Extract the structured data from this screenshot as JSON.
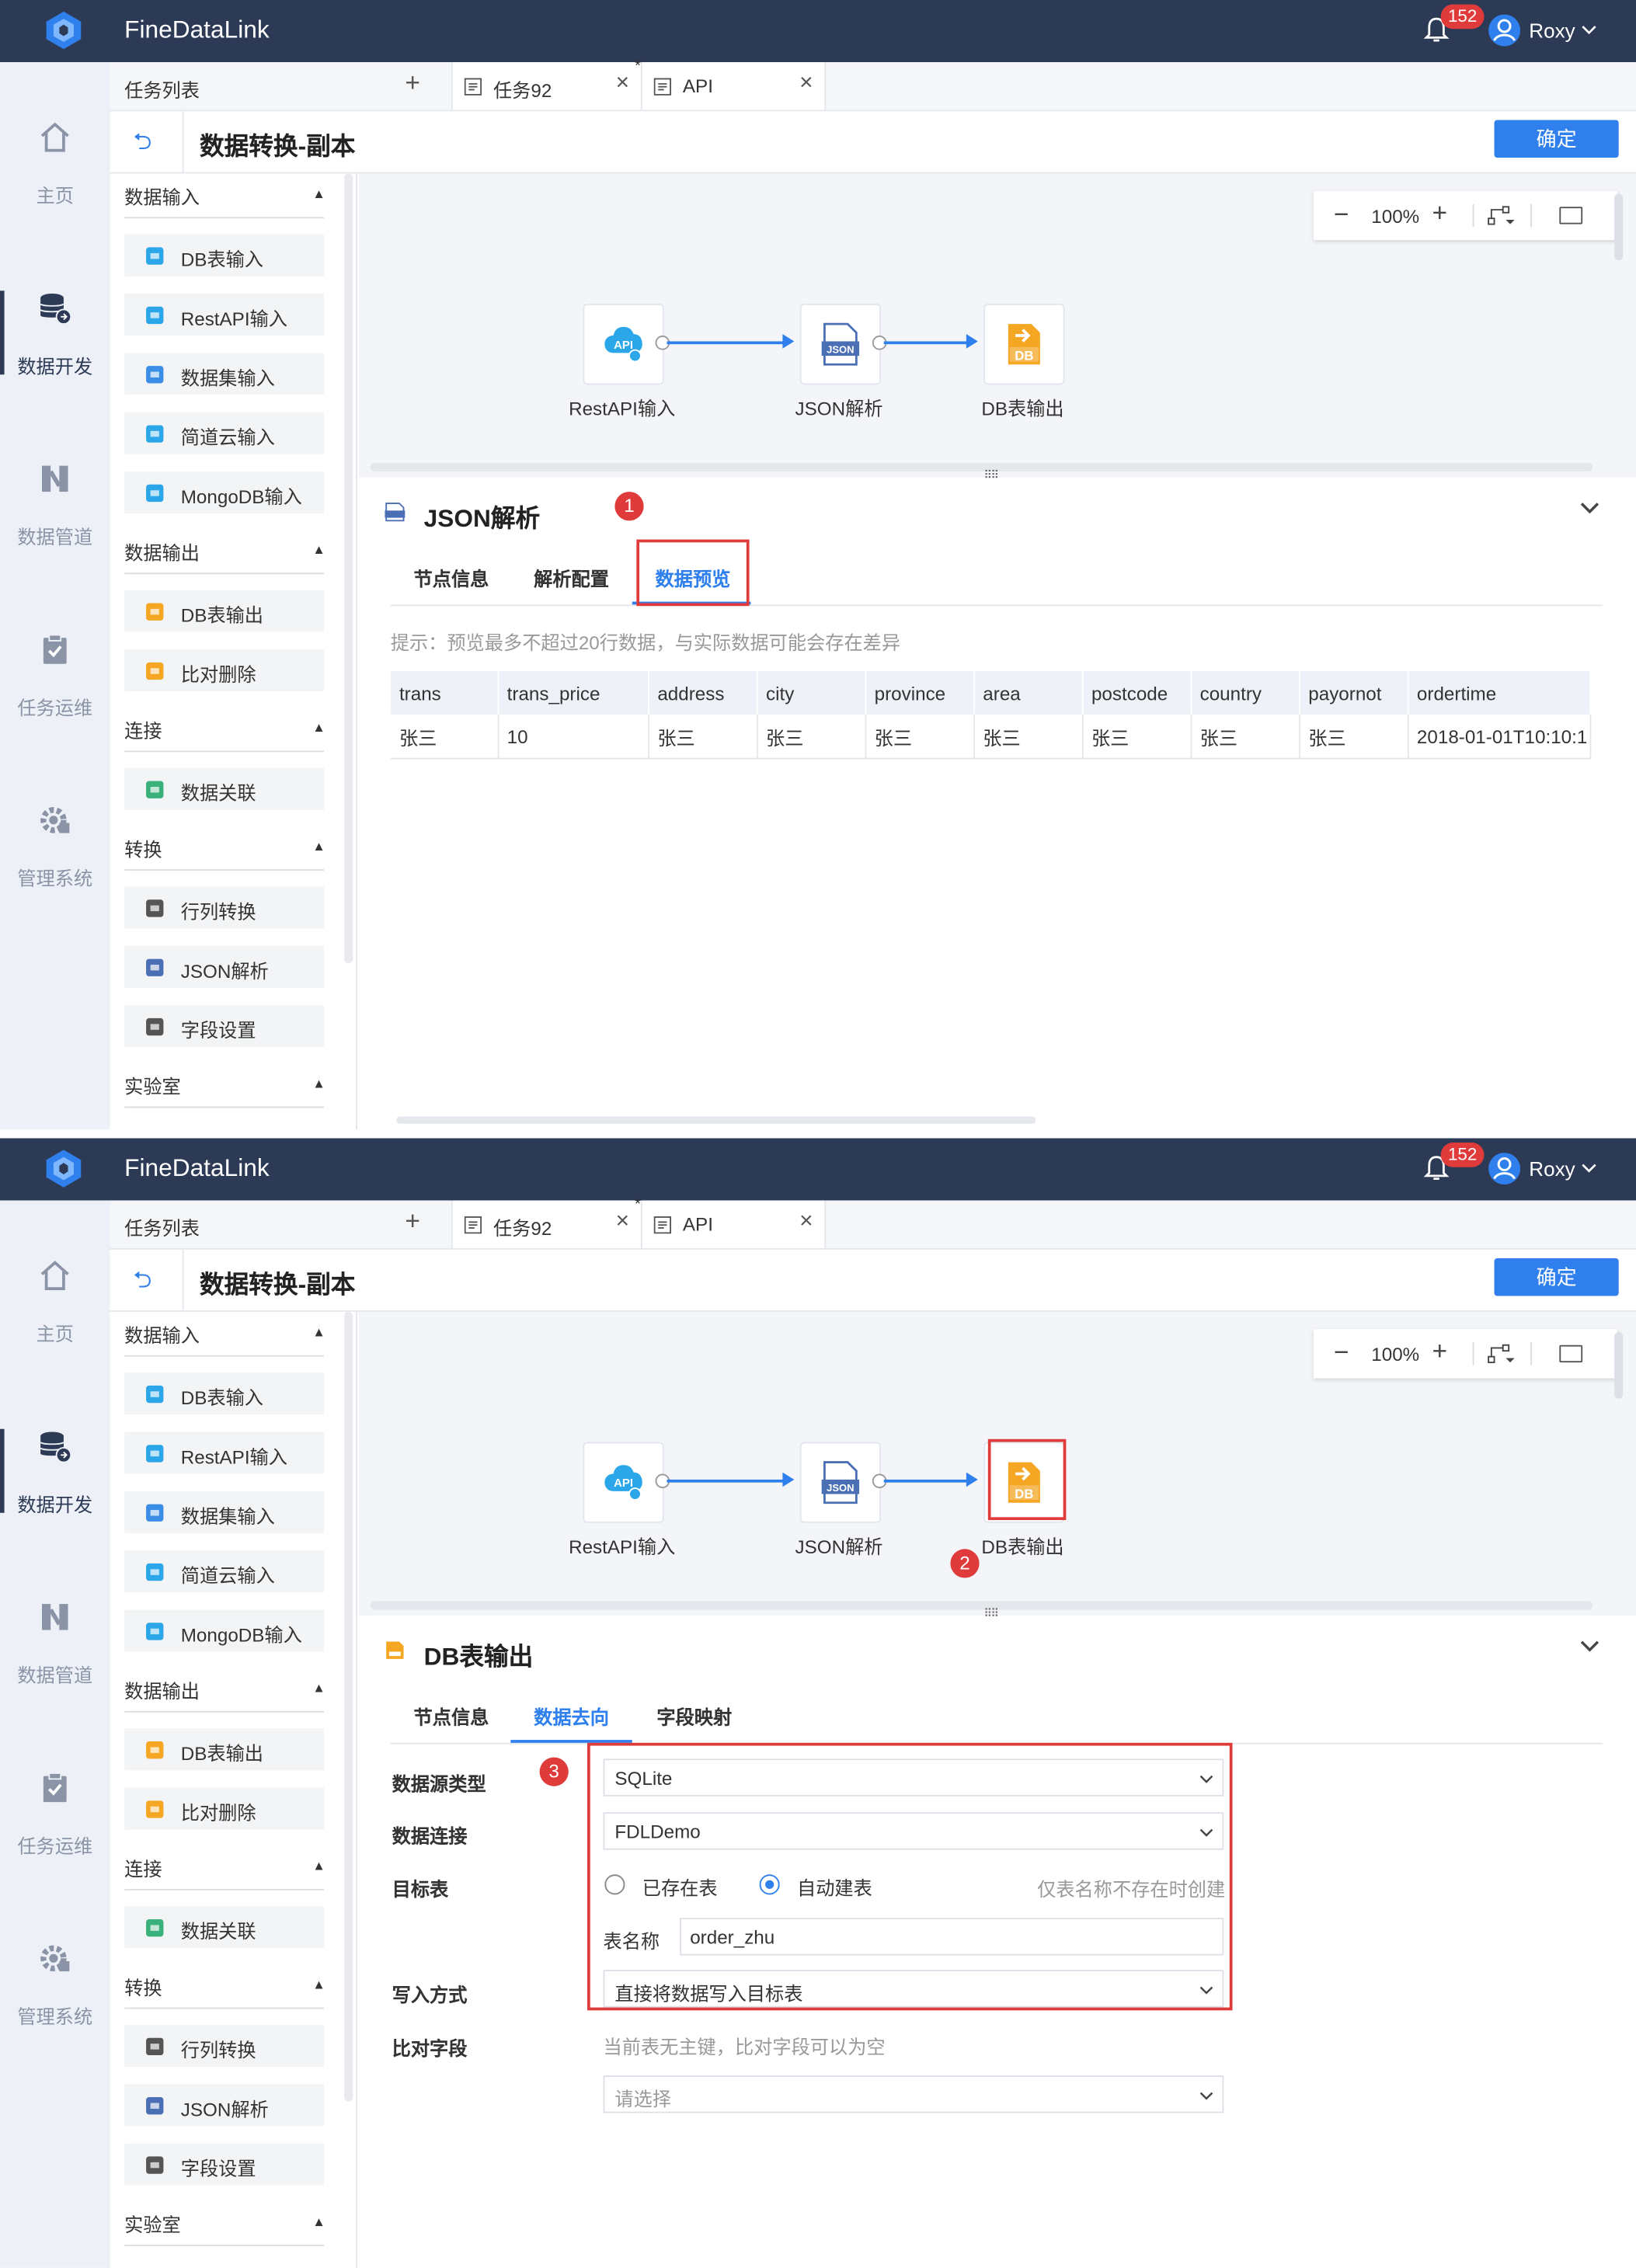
{
  "app": {
    "brand": "FineDataLink",
    "notification_count": "152",
    "user_name": "Roxy",
    "confirm_label": "确定",
    "page_title": "数据转换-副本",
    "tabs_list_label": "任务列表",
    "tabs": [
      {
        "label": "任务92",
        "modified": true
      },
      {
        "label": "API"
      }
    ]
  },
  "nav": [
    {
      "label": "主页",
      "icon": "home-icon"
    },
    {
      "label": "数据开发",
      "icon": "database-icon",
      "active": true
    },
    {
      "label": "数据管道",
      "icon": "pipeline-icon"
    },
    {
      "label": "任务运维",
      "icon": "clipboard-check-icon"
    },
    {
      "label": "管理系统",
      "icon": "gear-icon"
    }
  ],
  "palette": {
    "sections": [
      {
        "title": "数据输入",
        "items": [
          "DB表输入",
          "RestAPI输入",
          "数据集输入",
          "简道云输入",
          "MongoDB输入"
        ]
      },
      {
        "title": "数据输出",
        "items": [
          "DB表输出",
          "比对删除"
        ]
      },
      {
        "title": "连接",
        "items": [
          "数据关联"
        ]
      },
      {
        "title": "转换",
        "items": [
          "行列转换",
          "JSON解析",
          "字段设置"
        ]
      },
      {
        "title": "实验室",
        "items": []
      }
    ]
  },
  "canvas": {
    "zoom": "100%",
    "nodes": [
      {
        "label": "RestAPI输入",
        "icon": "api-icon"
      },
      {
        "label": "JSON解析",
        "icon": "json-file-icon"
      },
      {
        "label": "DB表输出",
        "icon": "db-output-icon"
      }
    ]
  },
  "shot1": {
    "panel_title": "JSON解析",
    "tabs": [
      "节点信息",
      "解析配置",
      "数据预览"
    ],
    "active_tab": 2,
    "hint": "提示：预览最多不超过20行数据，与实际数据可能会存在差异",
    "table": {
      "columns": [
        "trans",
        "trans_price",
        "address",
        "city",
        "province",
        "area",
        "postcode",
        "country",
        "payornot",
        "ordertime"
      ],
      "rows": [
        [
          "张三",
          "10",
          "张三",
          "张三",
          "张三",
          "张三",
          "张三",
          "张三",
          "张三",
          "2018-01-01T10:10:1"
        ]
      ]
    },
    "callout": "1"
  },
  "shot2": {
    "panel_title": "DB表输出",
    "tabs": [
      "节点信息",
      "数据去向",
      "字段映射"
    ],
    "active_tab": 1,
    "callouts": [
      "2",
      "3"
    ],
    "form": {
      "source_type_label": "数据源类型",
      "source_type_value": "SQLite",
      "connection_label": "数据连接",
      "connection_value": "FDLDemo",
      "target_label": "目标表",
      "radio_existing": "已存在表",
      "radio_auto": "自动建表",
      "radio_selected": "自动建表",
      "auto_note": "仅表名称不存在时创建",
      "table_name_label": "表名称",
      "table_name_value": "order_zhu",
      "write_mode_label": "写入方式",
      "write_mode_value": "直接将数据写入目标表",
      "compare_label": "比对字段",
      "compare_note": "当前表无主键，比对字段可以为空",
      "compare_placeholder": "请选择"
    }
  },
  "colors": {
    "topbar": "#2c3a55",
    "accent": "#2f80ed",
    "callout": "#e03b3b",
    "db_orange": "#f5a623"
  }
}
